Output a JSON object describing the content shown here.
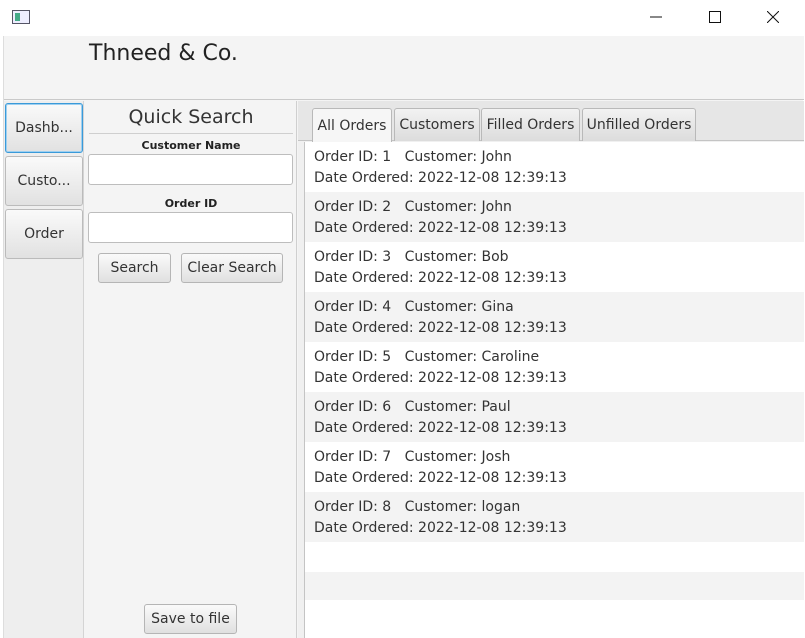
{
  "window": {
    "icon": "app-window-icon",
    "controls": {
      "minimize": "minimize-icon",
      "maximize": "maximize-icon",
      "close": "close-icon"
    }
  },
  "header": {
    "title": "Thneed & Co."
  },
  "nav": {
    "items": [
      {
        "label": "Dashb..."
      },
      {
        "label": "Custo..."
      },
      {
        "label": "Order"
      }
    ]
  },
  "quick_search": {
    "title": "Quick Search",
    "customer_name_label": "Customer Name",
    "customer_name_value": "",
    "order_id_label": "Order ID",
    "order_id_value": "",
    "search_label": "Search",
    "clear_label": "Clear Search",
    "save_label": "Save to file"
  },
  "tabs": [
    {
      "label": "All Orders",
      "active": true
    },
    {
      "label": "Customers",
      "active": false
    },
    {
      "label": "Filled Orders",
      "active": false
    },
    {
      "label": "Unfilled Orders",
      "active": false
    }
  ],
  "orders": [
    {
      "line1": "Order ID: 1   Customer: John",
      "line2": "Date Ordered: 2022-12-08 12:39:13"
    },
    {
      "line1": "Order ID: 2   Customer: John",
      "line2": "Date Ordered: 2022-12-08 12:39:13"
    },
    {
      "line1": "Order ID: 3   Customer: Bob",
      "line2": "Date Ordered: 2022-12-08 12:39:13"
    },
    {
      "line1": "Order ID: 4   Customer: Gina",
      "line2": "Date Ordered: 2022-12-08 12:39:13"
    },
    {
      "line1": "Order ID: 5   Customer: Caroline",
      "line2": "Date Ordered: 2022-12-08 12:39:13"
    },
    {
      "line1": "Order ID: 6   Customer: Paul",
      "line2": "Date Ordered: 2022-12-08 12:39:13"
    },
    {
      "line1": "Order ID: 7   Customer: Josh",
      "line2": "Date Ordered: 2022-12-08 12:39:13"
    },
    {
      "line1": "Order ID: 8   Customer: logan",
      "line2": "Date Ordered: 2022-12-08 12:39:13"
    }
  ],
  "colors": {
    "focus": "#3a9ad9",
    "row_alt": "#f3f3f3"
  }
}
